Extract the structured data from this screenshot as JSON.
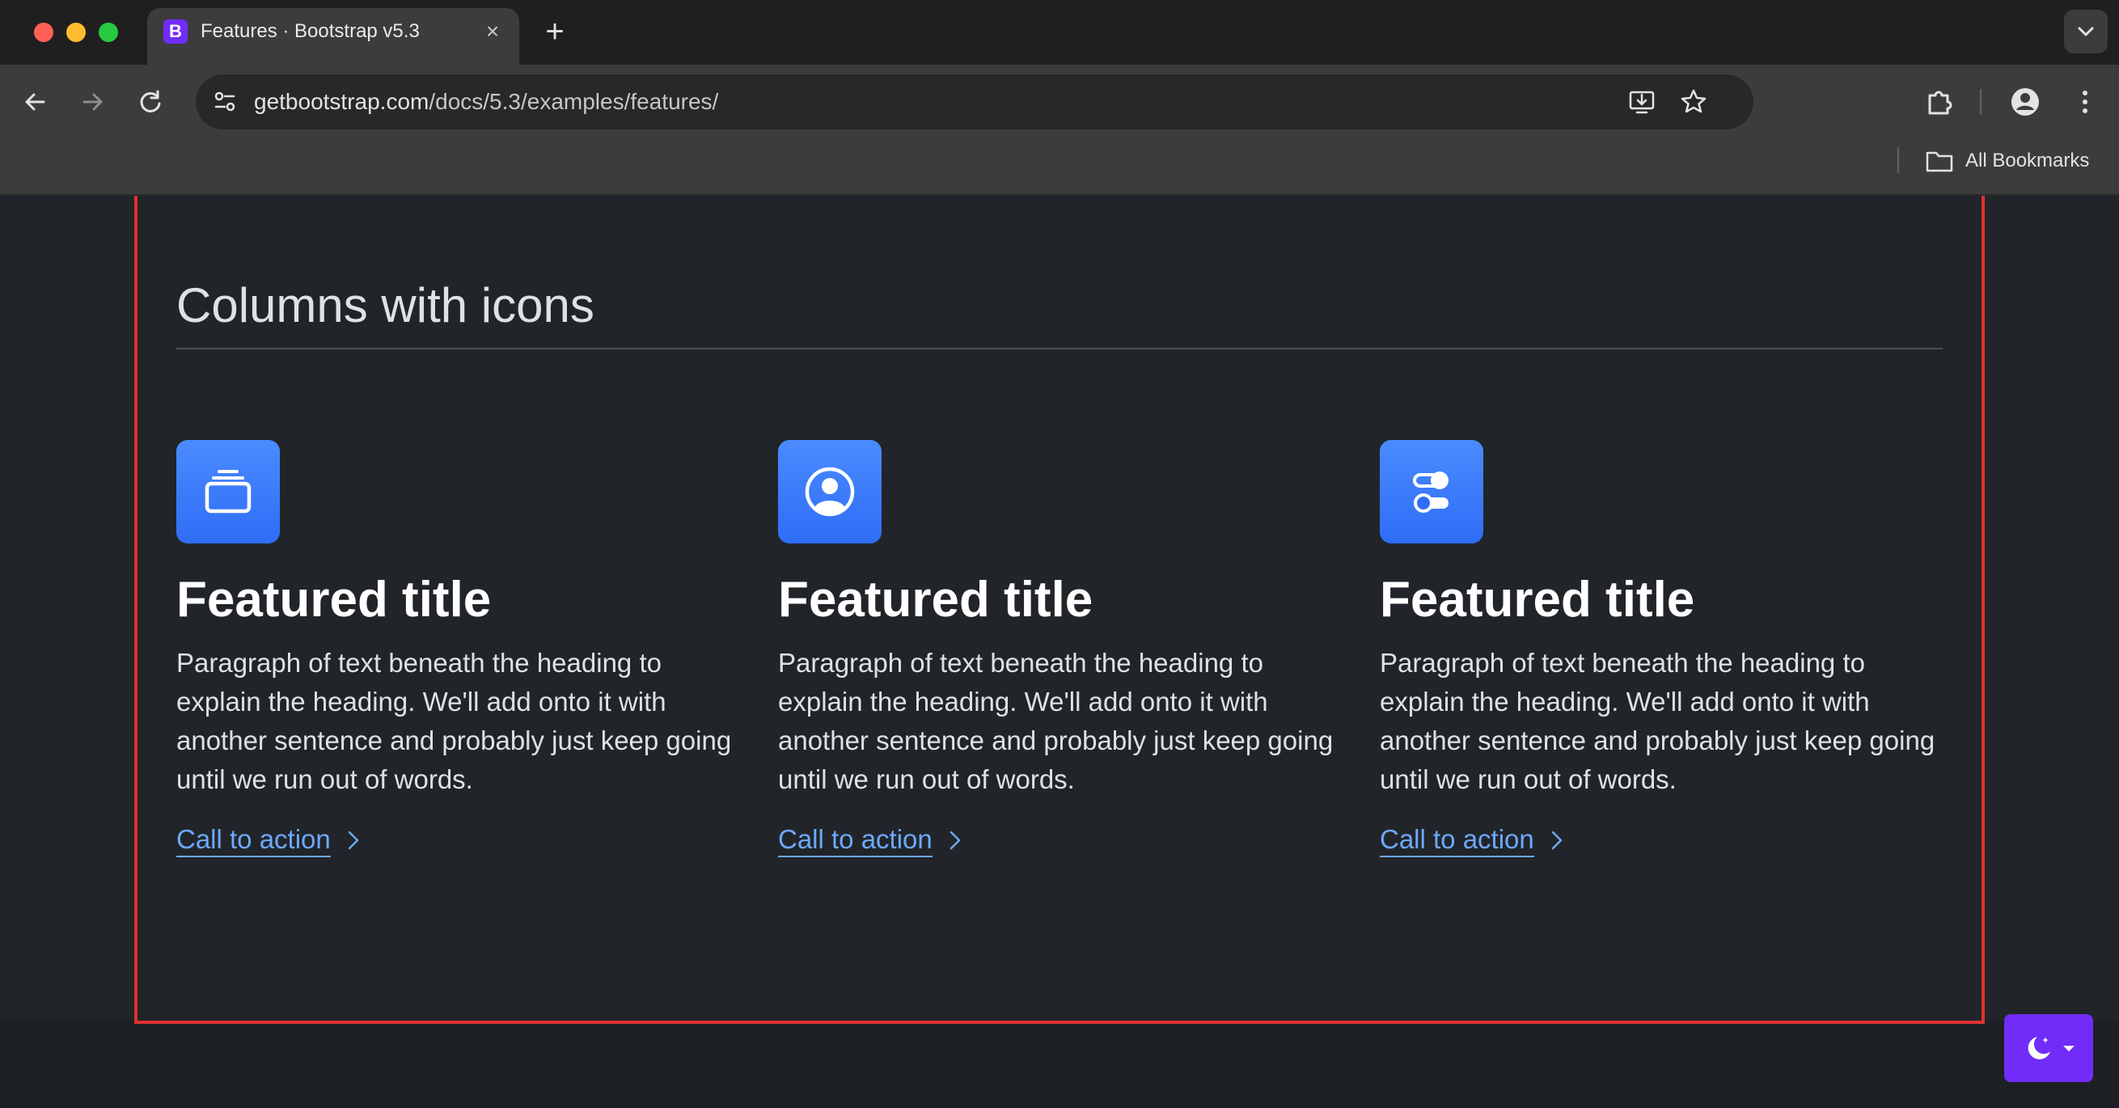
{
  "browser": {
    "tab_title": "Features · Bootstrap v5.3",
    "tab_favicon_letter": "B",
    "new_tab_glyph": "+",
    "close_glyph": "×",
    "url_host": "getbootstrap.com",
    "url_path": "/docs/5.3/examples/features/",
    "bookmarks_label": "All Bookmarks",
    "icons": [
      "back-icon",
      "forward-icon",
      "reload-icon",
      "site-info-icon",
      "install-app-icon",
      "star-icon",
      "extensions-icon",
      "profile-icon",
      "menu-icon",
      "folder-icon",
      "tab-search-icon"
    ]
  },
  "page": {
    "section_title": "Columns with icons",
    "features": [
      {
        "title": "Featured title",
        "text": "Paragraph of text beneath the heading to explain the heading. We'll add onto it with another sentence and probably just keep going until we run out of words.",
        "cta": "Call to action",
        "icon": "collection-icon"
      },
      {
        "title": "Featured title",
        "text": "Paragraph of text beneath the heading to explain the heading. We'll add onto it with another sentence and probably just keep going until we run out of words.",
        "cta": "Call to action",
        "icon": "person-circle-icon"
      },
      {
        "title": "Featured title",
        "text": "Paragraph of text beneath the heading to explain the heading. We'll add onto it with another sentence and probably just keep going until we run out of words.",
        "cta": "Call to action",
        "icon": "toggles-icon"
      }
    ],
    "theme_toggle_icon": "moon-stars-icon"
  },
  "colors": {
    "page_bg": "#212529",
    "accent": "#2f6df6",
    "link": "#6ea8fe",
    "highlight_border": "#e03131",
    "theme_button": "#712cf9"
  }
}
